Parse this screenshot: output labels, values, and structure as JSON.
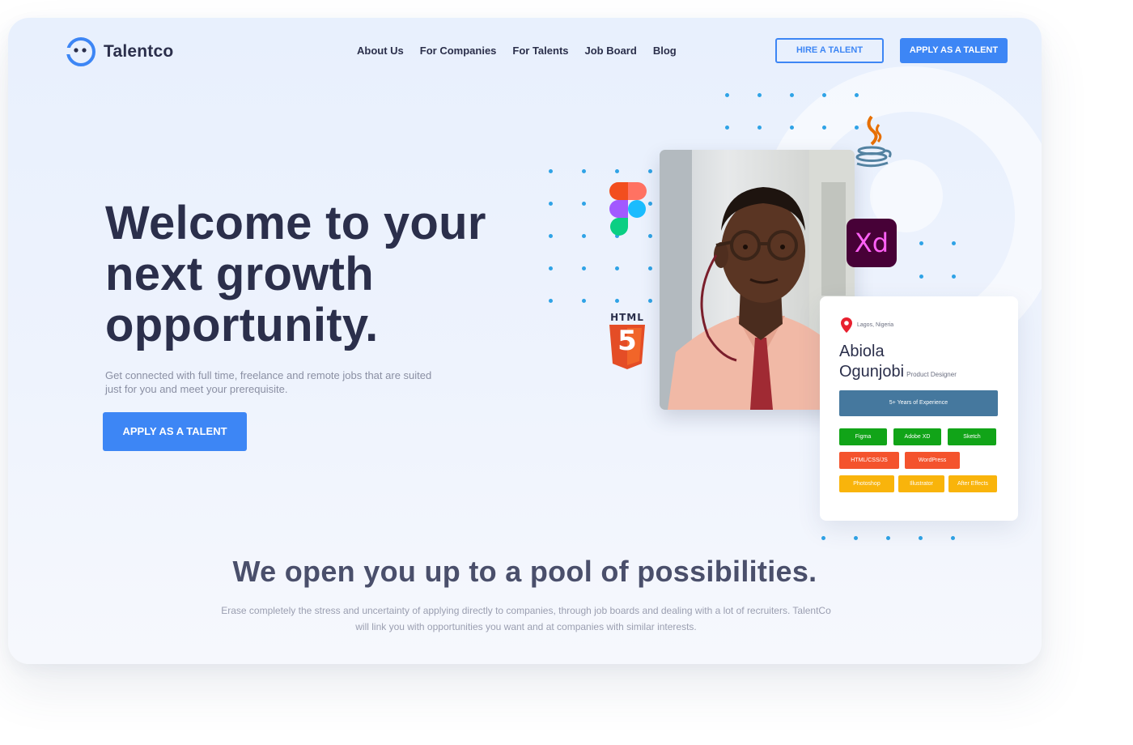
{
  "brand": {
    "name": "Talentco",
    "logo_icon": "logo-icon",
    "accent": "#3d86f5",
    "text_dark": "#2b2f4b"
  },
  "nav": {
    "items": [
      {
        "label": "About Us"
      },
      {
        "label": "For Companies"
      },
      {
        "label": "For Talents"
      },
      {
        "label": "Job Board"
      },
      {
        "label": "Blog"
      }
    ]
  },
  "header": {
    "hire_label": "HIRE A TALENT",
    "apply_label": "APPLY AS A TALENT"
  },
  "hero": {
    "title_line1": "Welcome to your",
    "title_line2": "next growth",
    "title_line3": "opportunity.",
    "subtitle": "Get connected with full time, freelance and remote jobs that are suited just for you and meet your prerequisite.",
    "cta_label": "APPLY AS A TALENT"
  },
  "tech_icons": {
    "figma": "figma-icon",
    "html5_label": "HTML",
    "html5_number": "5",
    "java": "java-icon",
    "xd_label": "Xd"
  },
  "profile": {
    "location": "Lagos, Nigeria",
    "first_name": "Abiola",
    "last_name": "Ogunjobi",
    "role": "Product Designer",
    "experience": "5+ Years of Experience",
    "skills_green": [
      "Figma",
      "Adobe XD",
      "Sketch"
    ],
    "skills_orange": [
      "HTML/CSS/JS",
      "WordPress"
    ],
    "skills_yellow": [
      "Photoshop",
      "Illustrator",
      "After Effects"
    ],
    "colors": {
      "green": "#11a418",
      "orange": "#f4532d",
      "yellow": "#f9b40b",
      "experience": "#45789e"
    }
  },
  "section": {
    "title": "We open you up to a pool of possibilities.",
    "text": "Erase completely the stress and uncertainty of applying directly to companies, through job boards and dealing with a lot of recruiters. TalentCo will link you with opportunities you want and at companies with similar interests."
  }
}
